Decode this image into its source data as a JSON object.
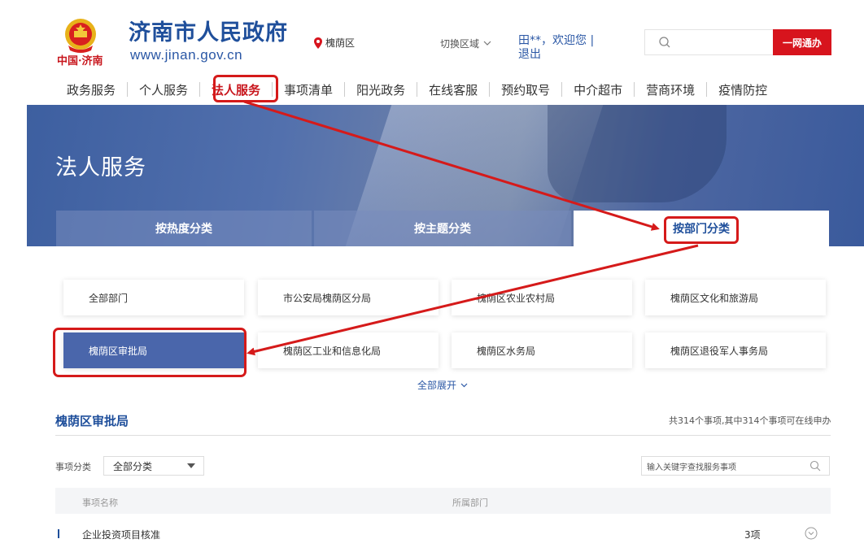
{
  "header": {
    "site_name": "济南市人民政府",
    "site_url": "www.jinan.gov.cn",
    "china_jinan": "中国·济南",
    "location": "槐荫区",
    "switch_region": "切换区域",
    "greeting": "田**，欢迎您 |",
    "logout": "退出",
    "search_button": "一网通办"
  },
  "nav": {
    "items": [
      {
        "label": "政务服务"
      },
      {
        "label": "个人服务"
      },
      {
        "label": "法人服务",
        "active": true
      },
      {
        "label": "事项清单"
      },
      {
        "label": "阳光政务"
      },
      {
        "label": "在线客服"
      },
      {
        "label": "预约取号"
      },
      {
        "label": "中介超市"
      },
      {
        "label": "营商环境"
      },
      {
        "label": "疫情防控"
      }
    ]
  },
  "banner": {
    "title": "法人服务",
    "tabs": [
      "按热度分类",
      "按主题分类",
      "按部门分类"
    ]
  },
  "departments": {
    "row1": [
      "全部部门",
      "市公安局槐荫区分局",
      "槐荫区农业农村局",
      "槐荫区文化和旅游局"
    ],
    "row2": [
      "槐荫区审批局",
      "槐荫区工业和信息化局",
      "槐荫区水务局",
      "槐荫区退役军人事务局"
    ],
    "expand_all": "全部展开"
  },
  "section": {
    "title": "槐荫区审批局",
    "count_text": "共314个事项,其中314个事项可在线申办",
    "filter_label": "事项分类",
    "filter_value": "全部分类",
    "keyword_placeholder": "输入关键字查找服务事项",
    "col_name": "事项名称",
    "col_dept": "所属部门",
    "rows": [
      {
        "name": "企业投资项目核准",
        "count": "3项"
      }
    ]
  },
  "colors": {
    "brand_blue": "#1f4f9b",
    "accent_red": "#d7141d",
    "annotation_red": "#d51a1a",
    "active_dept": "#4a66ab"
  }
}
